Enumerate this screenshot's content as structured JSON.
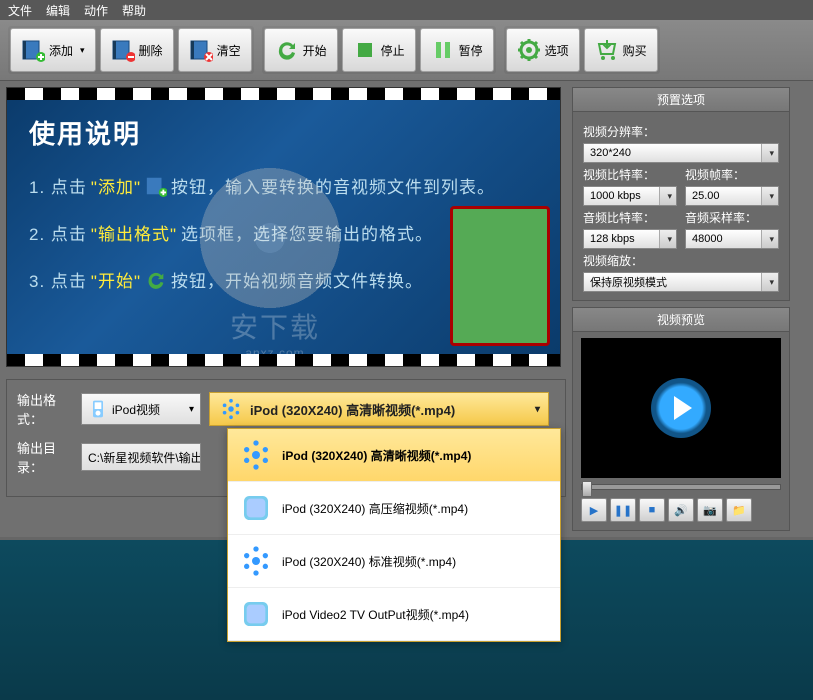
{
  "menu": {
    "file": "文件",
    "edit": "编辑",
    "action": "动作",
    "help": "帮助"
  },
  "toolbar": {
    "add": "添加",
    "delete": "删除",
    "clear": "清空",
    "start": "开始",
    "stop": "停止",
    "pause": "暂停",
    "options": "选项",
    "buy": "购买"
  },
  "instructions": {
    "title": "使用说明",
    "step1a": "1. 点击",
    "step1b": "\"添加\"",
    "step1c": "按钮，输入要转换的音视频文件到列表。",
    "step2a": "2. 点击",
    "step2b": "\"输出格式\"",
    "step2c": "选项框，选择您要输出的格式。",
    "step3a": "3. 点击",
    "step3b": "\"开始\"",
    "step3c": "按钮，开始视频音频文件转换。"
  },
  "watermark": {
    "main": "安下载",
    "sub": "anxz.com"
  },
  "output": {
    "format_label": "输出格式：",
    "dir_label": "输出目录：",
    "device": "iPod视频",
    "format_selected": "iPod (320X240) 高清晰视频(*.mp4)",
    "dir_value": "C:\\新星视频软件\\输出"
  },
  "format_options": [
    "iPod (320X240) 高清晰视频(*.mp4)",
    "iPod (320X240) 高压缩视频(*.mp4)",
    "iPod (320X240) 标准视频(*.mp4)",
    "iPod Video2 TV OutPut视频(*.mp4)"
  ],
  "preset": {
    "title": "预置选项",
    "resolution_label": "视频分辨率：",
    "resolution": "320*240",
    "vbitrate_label": "视频比特率：",
    "vbitrate": "1000 kbps",
    "fps_label": "视频帧率：",
    "fps": "25.00",
    "abitrate_label": "音频比特率：",
    "abitrate": "128 kbps",
    "samplerate_label": "音频采样率：",
    "samplerate": "48000",
    "zoom_label": "视频缩放：",
    "zoom": "保持原视频模式"
  },
  "preview": {
    "title": "视频预览"
  }
}
